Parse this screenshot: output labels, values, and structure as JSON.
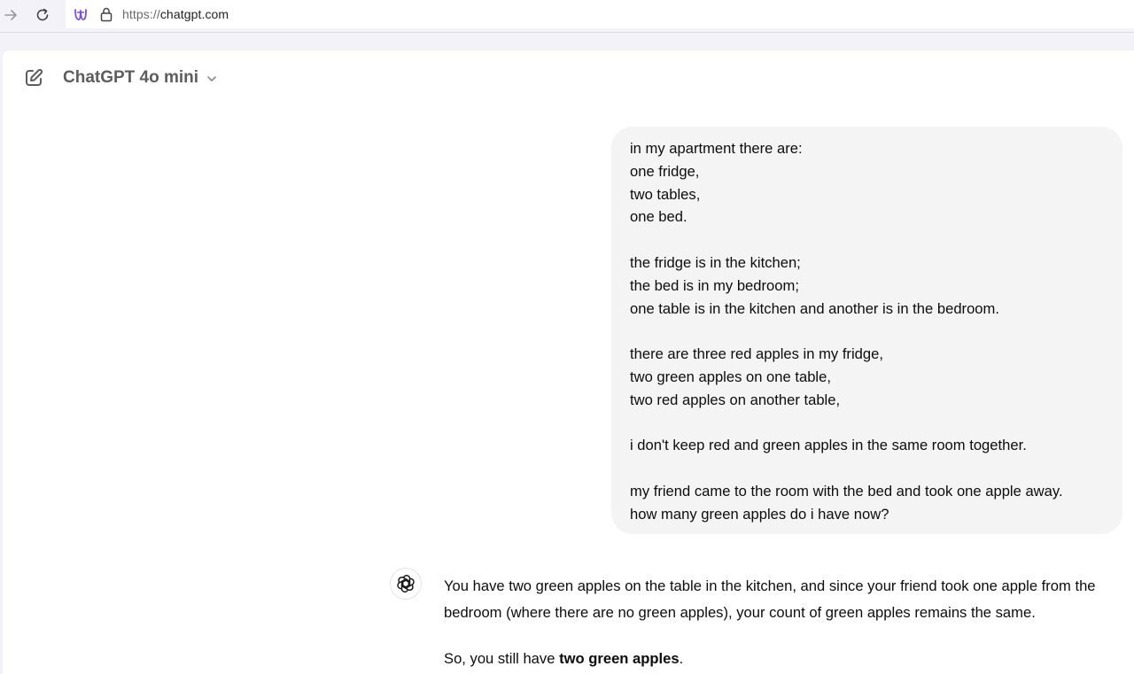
{
  "browser": {
    "url_scheme": "https://",
    "url_host": "chatgpt.com",
    "icons": {
      "forward": "arrow-right-icon",
      "reload": "reload-icon",
      "site": "site-logo-icon",
      "lock": "lock-icon"
    }
  },
  "header": {
    "new_chat_icon": "edit-pencil-icon",
    "model_name": "ChatGPT 4o mini",
    "model_chevron_icon": "chevron-down-icon"
  },
  "conversation": {
    "user_message": {
      "lines": [
        "in my apartment there are:",
        "one fridge,",
        "two tables,",
        "one bed.",
        "",
        "the fridge is in the kitchen;",
        "the bed is in my bedroom;",
        "one table is in the kitchen and another is in the bedroom.",
        "",
        "there are three red apples in my fridge,",
        "two green apples on one table,",
        "two red apples on another table,",
        "",
        "i don't keep red and green apples in the same room together.",
        "",
        "my friend came to the room with the bed and took one apple away.",
        "how many green apples do i have now?"
      ]
    },
    "assistant_message": {
      "avatar_icon": "openai-logo-icon",
      "paragraph_1": "You have two green apples on the table in the kitchen, and since your friend took one apple from the bedroom (where there are no green apples), your count of green apples remains the same.",
      "paragraph_2_prefix": "So, you still have ",
      "paragraph_2_bold": "two green apples",
      "paragraph_2_suffix": "."
    }
  },
  "colors": {
    "chrome_background": "#f3f2f8",
    "page_background": "#ffffff",
    "user_bubble": "#f4f4f4",
    "text": "#0d0d0d",
    "model_name": "#5d5d5d",
    "site_icon": "#7b4fd6"
  }
}
